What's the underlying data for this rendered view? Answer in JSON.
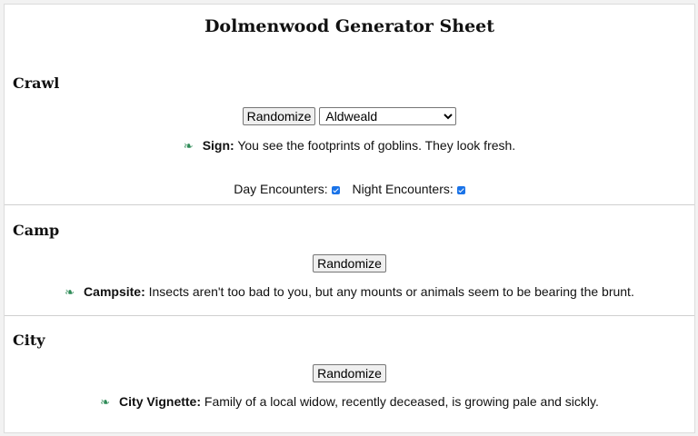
{
  "page": {
    "title": "Dolmenwood Generator Sheet"
  },
  "crawl": {
    "heading": "Crawl",
    "randomize_label": "Randomize",
    "region_selected": "Aldweald",
    "result_label": "Sign:",
    "result_text": "You see the footprints of goblins. They look fresh.",
    "day_label": "Day Encounters:",
    "day_checked": true,
    "night_label": "Night Encounters:",
    "night_checked": true
  },
  "camp": {
    "heading": "Camp",
    "randomize_label": "Randomize",
    "result_label": "Campsite:",
    "result_text": "Insects aren't too bad to you, but any mounts or animals seem to be bearing the brunt."
  },
  "city": {
    "heading": "City",
    "randomize_label": "Randomize",
    "result_label": "City Vignette:",
    "result_text": "Family of a local widow, recently deceased, is growing pale and sickly."
  },
  "colors": {
    "bullet": "#2e8b57",
    "checkbox": "#1a73e8"
  },
  "icons": {
    "bullet": "floral-heart-bullet-icon"
  }
}
